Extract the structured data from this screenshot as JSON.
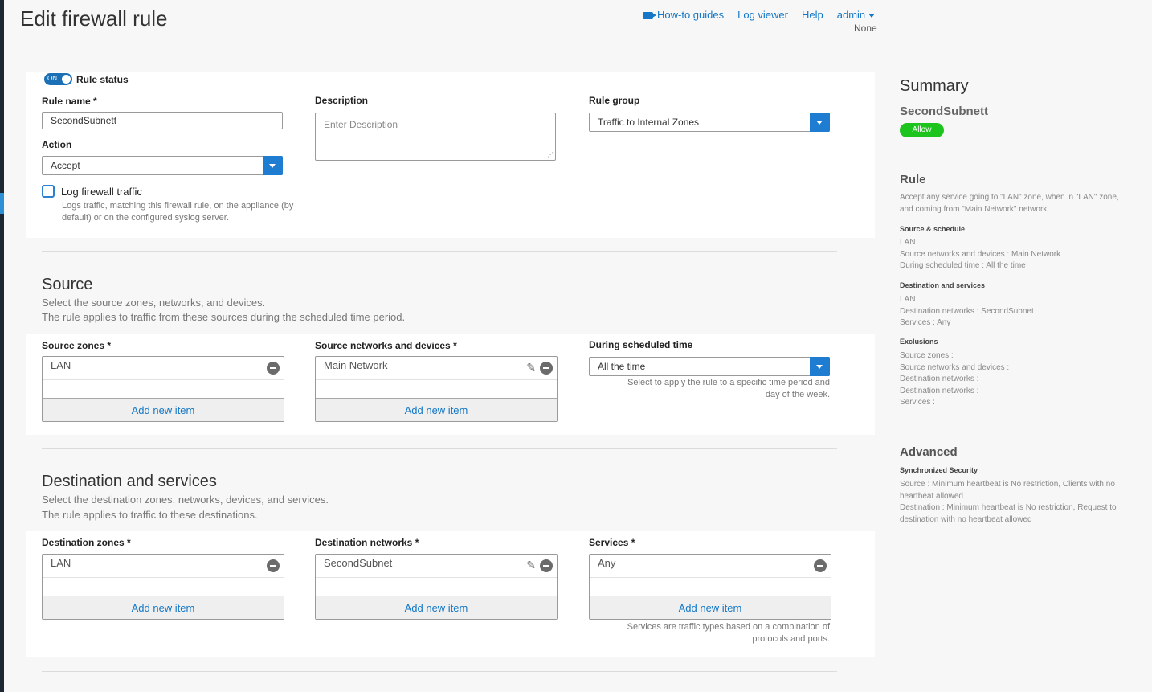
{
  "page": {
    "title": "Edit firewall rule"
  },
  "topnav": {
    "howto": "How-to guides",
    "logviewer": "Log viewer",
    "help": "Help",
    "user": "admin",
    "sub": "None"
  },
  "rule": {
    "status_on": "ON",
    "status_label": "Rule status",
    "name_label": "Rule name *",
    "name_value": "SecondSubnett",
    "description_label": "Description",
    "description_placeholder": "Enter Description",
    "group_label": "Rule group",
    "group_value": "Traffic to Internal Zones",
    "action_label": "Action",
    "action_value": "Accept",
    "log_label": "Log firewall traffic",
    "log_help": "Logs traffic, matching this firewall rule, on the appliance (by default) or on the configured syslog server."
  },
  "source": {
    "title": "Source",
    "desc1": "Select the source zones, networks, and devices.",
    "desc2": "The rule applies to traffic from these sources during the scheduled time period.",
    "zones_label": "Source zones *",
    "zones_item": "LAN",
    "networks_label": "Source networks and devices *",
    "networks_item": "Main Network",
    "schedule_label": "During scheduled time",
    "schedule_value": "All the time",
    "schedule_help": "Select to apply the rule to a specific time period and day of the week.",
    "add_label": "Add new item"
  },
  "destination": {
    "title": "Destination and services",
    "desc1": "Select the destination zones, networks, devices, and services.",
    "desc2": "The rule applies to traffic to these destinations.",
    "zones_label": "Destination zones *",
    "zones_item": "LAN",
    "networks_label": "Destination networks *",
    "networks_item": "SecondSubnet",
    "services_label": "Services *",
    "services_item": "Any",
    "services_help": "Services are traffic types based on a combination of protocols and ports.",
    "add_label": "Add new item"
  },
  "summary": {
    "title": "Summary",
    "name": "SecondSubnett",
    "badge": "Allow",
    "rule_heading": "Rule",
    "rule_text": "Accept any service going to \"LAN\" zone, when in \"LAN\" zone, and coming from \"Main Network\" network",
    "src_heading": "Source & schedule",
    "src_lines": [
      "LAN",
      "Source networks and devices : Main Network",
      "During scheduled time : All the time"
    ],
    "dst_heading": "Destination and services",
    "dst_lines": [
      "LAN",
      "Destination networks : SecondSubnet",
      "Services : Any"
    ],
    "exc_heading": "Exclusions",
    "exc_lines": [
      "Source zones :",
      "Source networks and devices :",
      "Destination networks :",
      "Destination networks :",
      "Services :"
    ],
    "adv_heading": "Advanced",
    "sync_heading": "Synchronized Security",
    "sync_src": "Source : Minimum heartbeat is No restriction, Clients with no heartbeat allowed",
    "sync_dst": "Destination : Minimum heartbeat is No restriction, Request to destination with no heartbeat allowed"
  }
}
